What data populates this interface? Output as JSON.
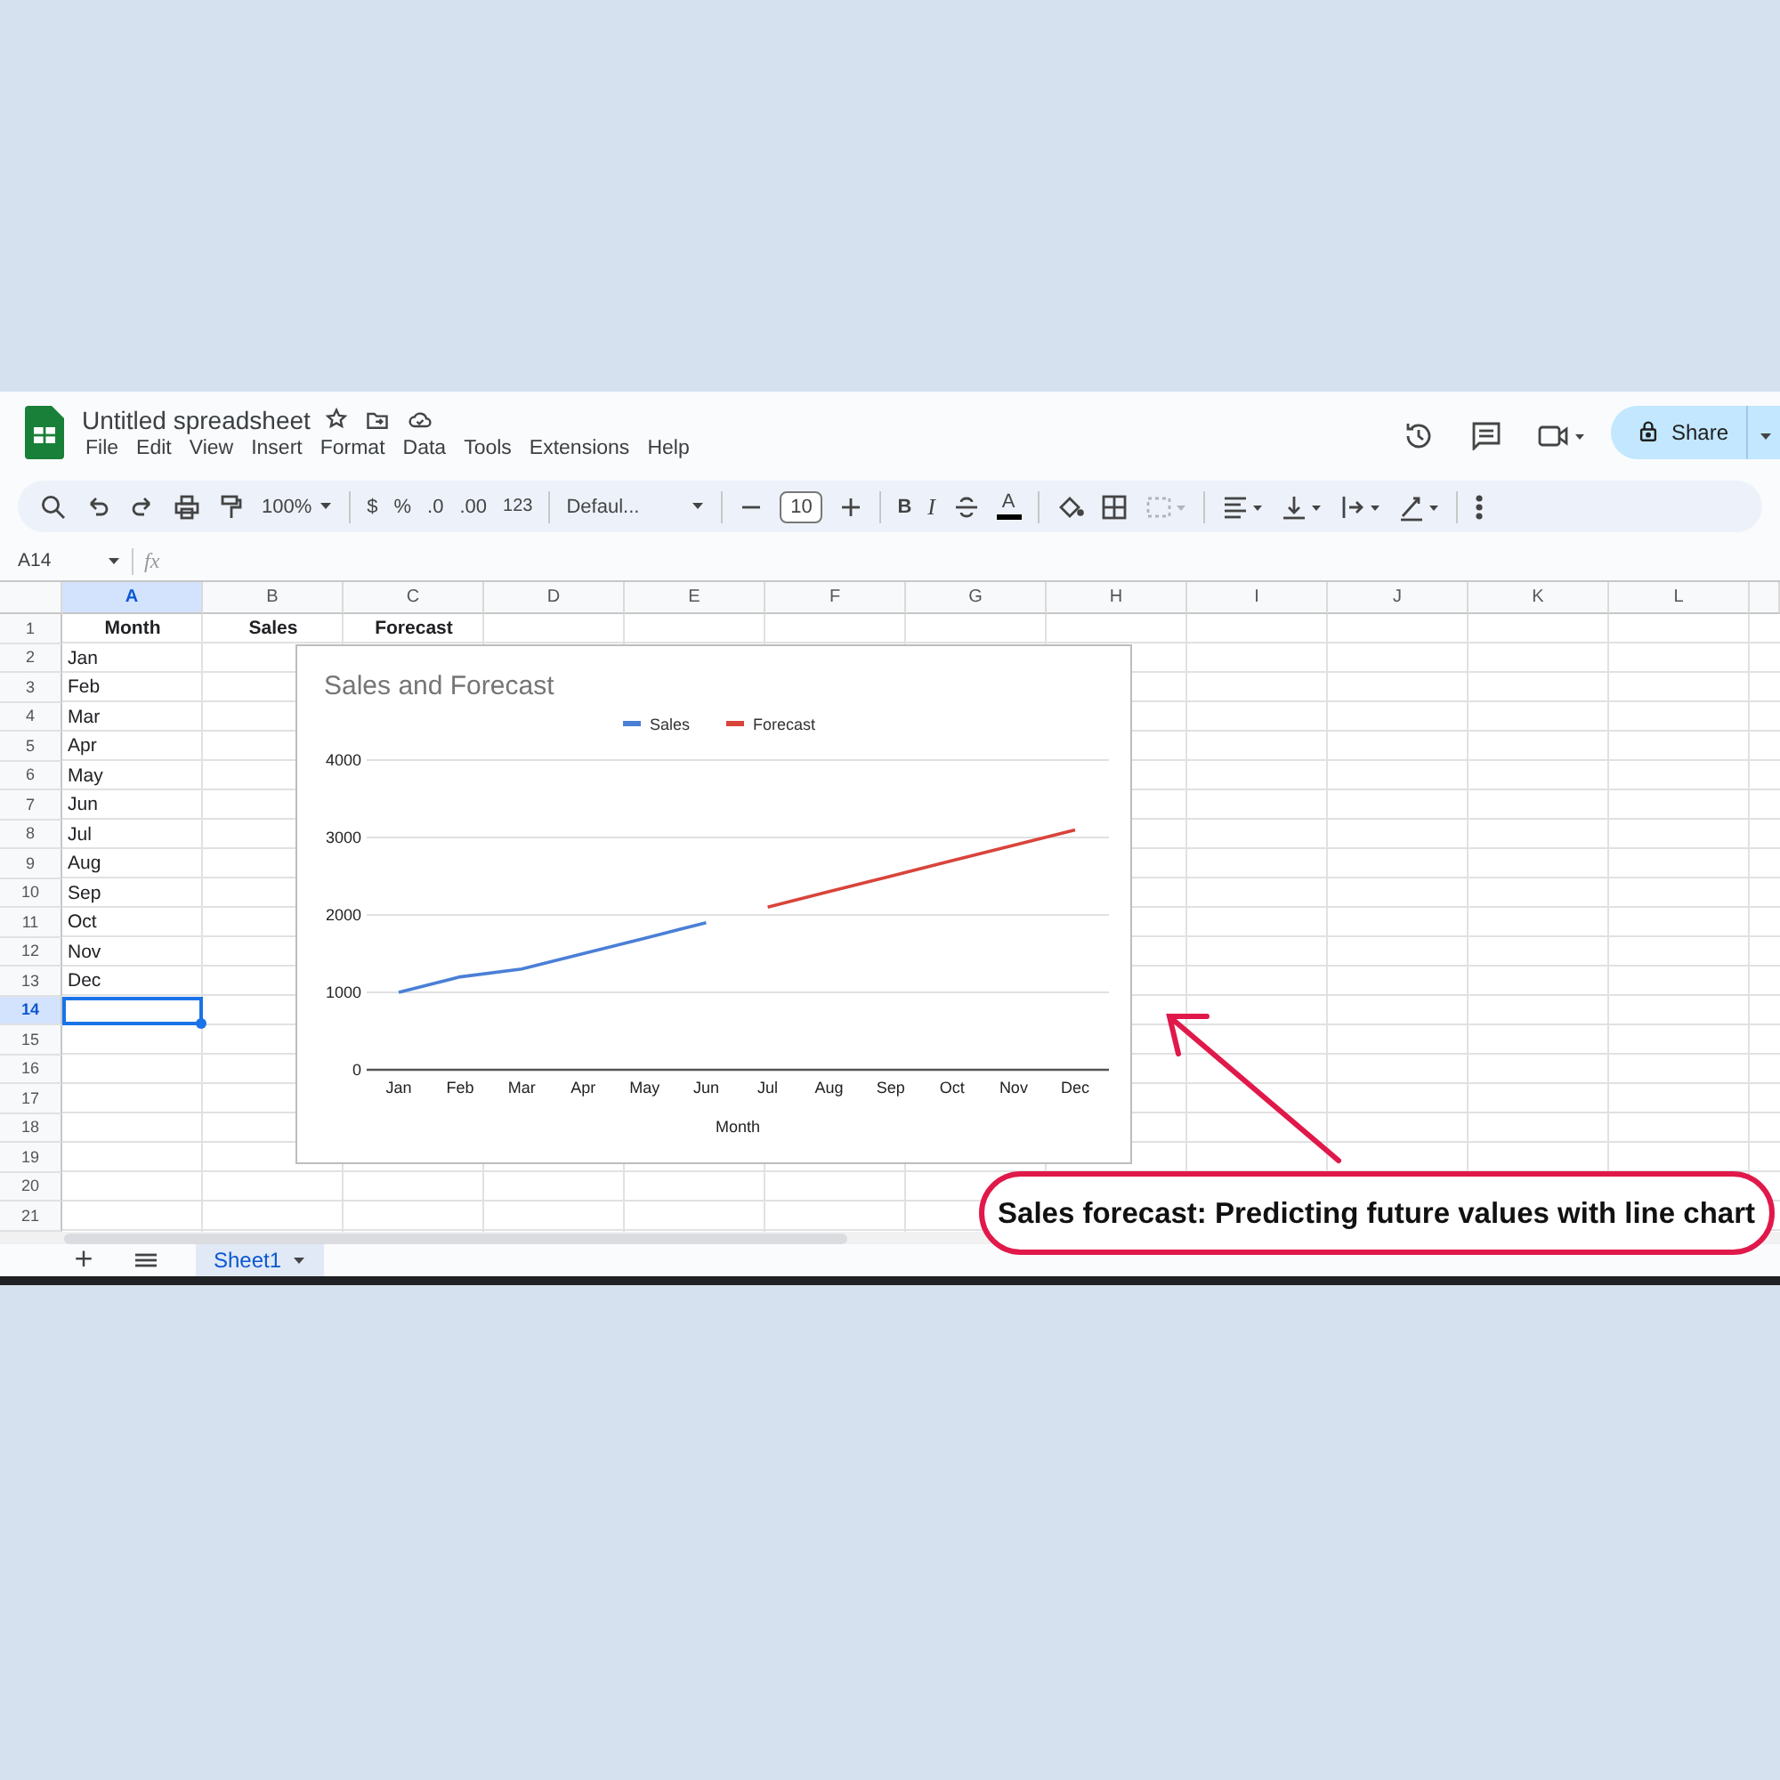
{
  "app": {
    "title": "Untitled spreadsheet",
    "menu": [
      "File",
      "Edit",
      "View",
      "Insert",
      "Format",
      "Data",
      "Tools",
      "Extensions",
      "Help"
    ],
    "share": "Share"
  },
  "toolbar": {
    "zoom": "100%",
    "currency": "$",
    "percent": "%",
    "decrease_decimals": ".0",
    "increase_decimals": ".00",
    "number_format": "123",
    "font": "Defaul...",
    "font_size": "10",
    "bold": "B",
    "italic": "I",
    "text_color": "A",
    "merge": {
      "disabled": true
    }
  },
  "formula_bar": {
    "cell": "A14",
    "fx": "fx"
  },
  "columns": [
    {
      "label": "A",
      "selected": true
    },
    {
      "label": "B",
      "selected": false
    },
    {
      "label": "C",
      "selected": false
    },
    {
      "label": "D",
      "selected": false
    },
    {
      "label": "E",
      "selected": false
    },
    {
      "label": "F",
      "selected": false
    },
    {
      "label": "G",
      "selected": false
    },
    {
      "label": "H",
      "selected": false
    },
    {
      "label": "I",
      "selected": false
    },
    {
      "label": "J",
      "selected": false
    },
    {
      "label": "K",
      "selected": false
    },
    {
      "label": "L",
      "selected": false
    }
  ],
  "rows": [
    {
      "number": "1",
      "selected": false,
      "cells": [
        "Month",
        "Sales",
        "Forecast"
      ]
    },
    {
      "number": "2",
      "selected": false,
      "cells": [
        "Jan"
      ]
    },
    {
      "number": "3",
      "selected": false,
      "cells": [
        "Feb"
      ]
    },
    {
      "number": "4",
      "selected": false,
      "cells": [
        "Mar"
      ]
    },
    {
      "number": "5",
      "selected": false,
      "cells": [
        "Apr"
      ]
    },
    {
      "number": "6",
      "selected": false,
      "cells": [
        "May"
      ]
    },
    {
      "number": "7",
      "selected": false,
      "cells": [
        "Jun"
      ]
    },
    {
      "number": "8",
      "selected": false,
      "cells": [
        "Jul"
      ]
    },
    {
      "number": "9",
      "selected": false,
      "cells": [
        "Aug"
      ]
    },
    {
      "number": "10",
      "selected": false,
      "cells": [
        "Sep"
      ]
    },
    {
      "number": "11",
      "selected": false,
      "cells": [
        "Oct"
      ]
    },
    {
      "number": "12",
      "selected": false,
      "cells": [
        "Nov"
      ]
    },
    {
      "number": "13",
      "selected": false,
      "cells": [
        "Dec"
      ]
    },
    {
      "number": "14",
      "selected": true,
      "cells": []
    },
    {
      "number": "15",
      "selected": false,
      "cells": []
    },
    {
      "number": "16",
      "selected": false,
      "cells": []
    },
    {
      "number": "17",
      "selected": false,
      "cells": []
    },
    {
      "number": "18",
      "selected": false,
      "cells": []
    },
    {
      "number": "19",
      "selected": false,
      "cells": []
    },
    {
      "number": "20",
      "selected": false,
      "cells": []
    },
    {
      "number": "21",
      "selected": false,
      "cells": []
    }
  ],
  "chart": {
    "chart_data": {
      "type": "line",
      "title": "Sales and Forecast",
      "xlabel": "Month",
      "categories": [
        "Jan",
        "Feb",
        "Mar",
        "Apr",
        "May",
        "Jun",
        "Jul",
        "Aug",
        "Sep",
        "Oct",
        "Nov",
        "Dec"
      ],
      "series": [
        {
          "name": "Sales",
          "color": "#4a7fd6",
          "values": [
            1000,
            1200,
            1300,
            1500,
            1700,
            1900,
            null,
            null,
            null,
            null,
            null,
            null
          ]
        },
        {
          "name": "Forecast",
          "color": "#d9443a",
          "values": [
            null,
            null,
            null,
            null,
            null,
            null,
            2100,
            2300,
            2500,
            2700,
            2900,
            3100
          ]
        }
      ],
      "ylim": [
        0,
        4000
      ],
      "yticks": [
        0,
        1000,
        2000,
        3000,
        4000
      ],
      "grid": true,
      "legend": "top"
    }
  },
  "sheet_tabs": [
    {
      "label": "Sheet1",
      "selected": true
    }
  ],
  "annotation": "Sales forecast: Predicting future values with line chart"
}
